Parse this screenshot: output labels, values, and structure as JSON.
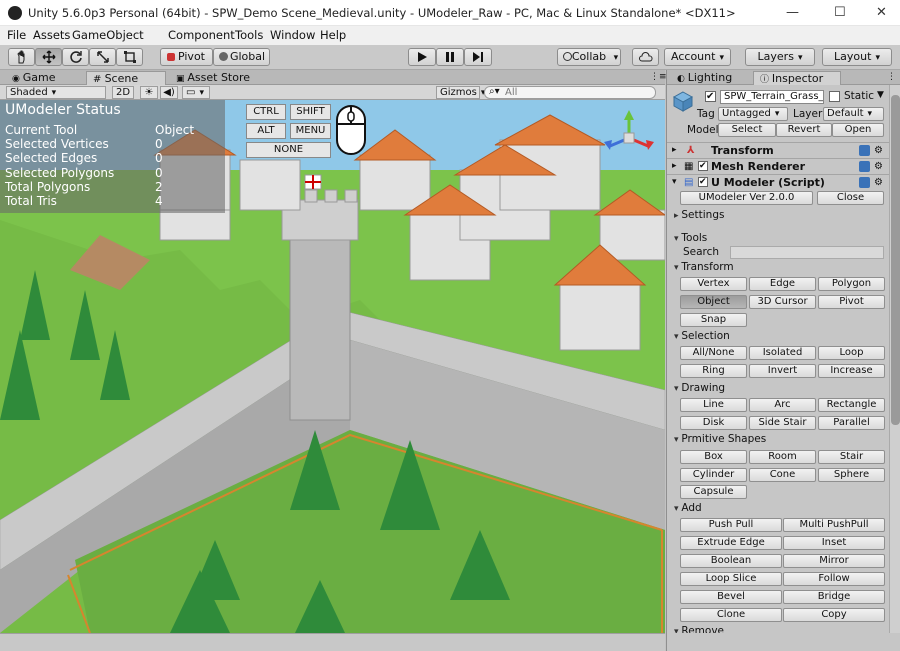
{
  "window": {
    "title": "Unity 5.6.0p3 Personal (64bit) - SPW_Demo Scene_Medieval.unity - UModeler_Raw - PC, Mac & Linux Standalone* <DX11>"
  },
  "menu": [
    "File",
    "Assets",
    "GameObject",
    "Component",
    "Tools",
    "Window",
    "Help"
  ],
  "toolbar": {
    "pivot": "Pivot",
    "global": "Global",
    "collab": "Collab",
    "account": "Account",
    "layers": "Layers",
    "layout": "Layout"
  },
  "tabs": {
    "game": "Game",
    "scene": "Scene",
    "asset_store": "Asset Store",
    "lighting": "Lighting",
    "inspector": "Inspector"
  },
  "scene_toolbar": {
    "shading": "Shaded",
    "mode_2d": "2D",
    "gizmos": "Gizmos",
    "search_placeholder": "All"
  },
  "umodeler_status": {
    "title": "UModeler Status",
    "rows": [
      {
        "label": "Current Tool",
        "value": "Object"
      },
      {
        "label": "Selected Vertices",
        "value": "0"
      },
      {
        "label": "Selected Edges",
        "value": "0"
      },
      {
        "label": "Selected Polygons",
        "value": "0"
      },
      {
        "label": "Total Polygons",
        "value": "2"
      },
      {
        "label": "Total Tris",
        "value": "4"
      }
    ]
  },
  "key_overlay": {
    "ctrl": "CTRL",
    "shift": "SHIFT",
    "alt": "ALT",
    "menu": "MENU",
    "none": "NONE"
  },
  "inspector": {
    "object_name": "SPW_Terrain_Grass_",
    "static": "Static",
    "tag_label": "Tag",
    "tag_value": "Untagged",
    "layer_label": "Layer",
    "layer_value": "Default",
    "model_label": "Model",
    "model_select": "Select",
    "model_revert": "Revert",
    "model_open": "Open",
    "components": [
      "Transform",
      "Mesh Renderer",
      "U Modeler (Script)"
    ],
    "version_button": "UModeler Ver 2.0.0",
    "close_button": "Close",
    "settings": "Settings",
    "tools": "Tools",
    "search_label": "Search",
    "transform_section": "Transform",
    "transform_buttons": [
      "Vertex",
      "Edge",
      "Polygon",
      "Object",
      "3D Cursor",
      "Pivot",
      "Snap"
    ],
    "selection_section": "Selection",
    "selection_buttons": [
      "All/None",
      "Isolated",
      "Loop",
      "Ring",
      "Invert",
      "Increase"
    ],
    "drawing_section": "Drawing",
    "drawing_buttons": [
      "Line",
      "Arc",
      "Rectangle",
      "Disk",
      "Side Stair",
      "Parallel"
    ],
    "primitive_section": "Prmitive Shapes",
    "primitive_buttons": [
      "Box",
      "Room",
      "Stair",
      "Cylinder",
      "Cone",
      "Sphere",
      "Capsule"
    ],
    "add_section": "Add",
    "add_buttons": [
      "Push Pull",
      "Multi PushPull",
      "Extrude Edge",
      "Inset",
      "Boolean",
      "Mirror",
      "Loop Slice",
      "Follow",
      "Bevel",
      "Bridge",
      "Clone",
      "Copy"
    ],
    "remove_section": "Remove"
  }
}
